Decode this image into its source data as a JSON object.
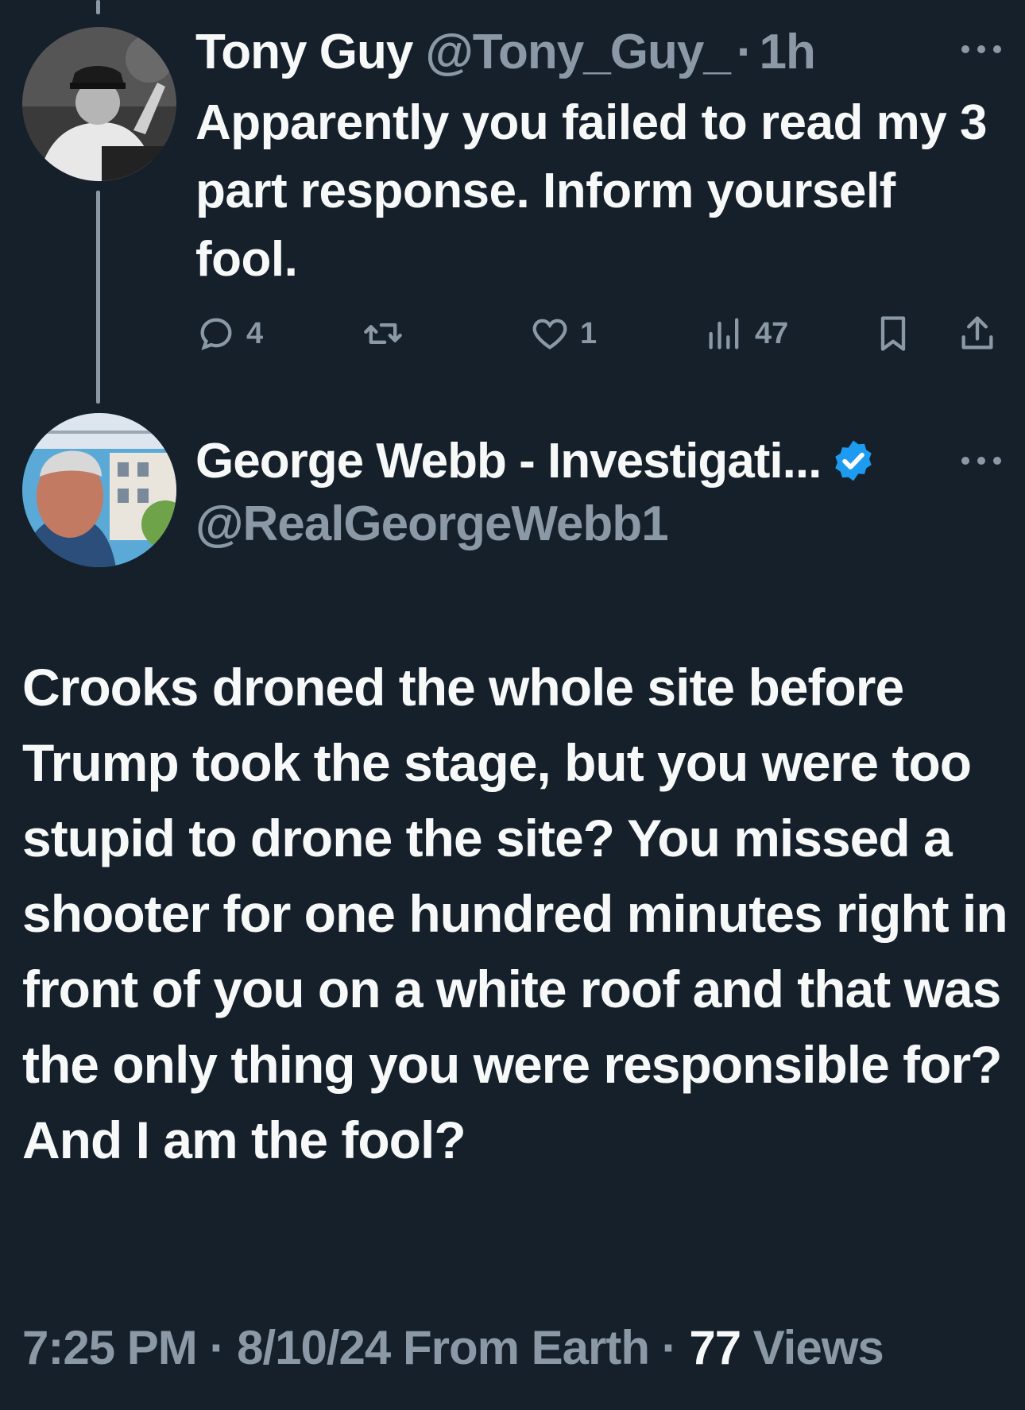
{
  "reply": {
    "name": "Tony Guy",
    "handle": "@Tony_Guy_",
    "separator": "·",
    "time": "1h",
    "text": "Apparently you failed to read my 3 part response. Inform yourself fool.",
    "stats": {
      "replies": "4",
      "likes": "1",
      "views": "47"
    }
  },
  "main": {
    "name": "George Webb - Investigati...",
    "handle": "@RealGeorgeWebb1",
    "text": "Crooks droned the whole site before Trump took the stage, but you were too stupid to drone the site?  You missed a shooter for one hundred minutes right in front of you on a white roof and that was the only thing you were responsible for?  And I am the fool?",
    "meta": {
      "time": "7:25 PM",
      "sep1": "·",
      "date": "8/10/24",
      "source": "From Earth",
      "sep2": "·",
      "views_count": "77",
      "views_label": "Views"
    }
  },
  "colors": {
    "background": "#15202b",
    "text": "#f7f9f9",
    "secondary": "#8b98a5",
    "verified": "#1d9bf0"
  },
  "icons": [
    "more-icon",
    "reply-icon",
    "retweet-icon",
    "like-icon",
    "views-icon",
    "bookmark-icon",
    "share-icon",
    "verified-badge-icon"
  ]
}
